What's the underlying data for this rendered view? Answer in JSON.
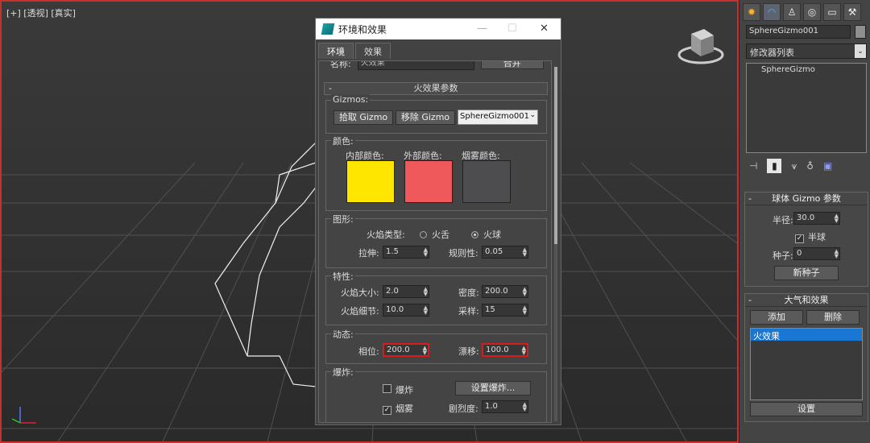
{
  "viewport": {
    "label": "[+] [透视] [真实]"
  },
  "dialog": {
    "title": "环境和效果",
    "tabs": [
      "环境",
      "效果"
    ],
    "top_row": {
      "name_label": "名称:",
      "name_value": "火效果",
      "merge_label": "合并"
    },
    "rollout_title": "火效果参数",
    "gizmos": {
      "label": "Gizmos:",
      "pick_button": "拾取 Gizmo",
      "remove_button": "移除 Gizmo",
      "selected": "SphereGizmo001"
    },
    "colors": {
      "label": "颜色:",
      "inner_label": "内部颜色:",
      "outer_label": "外部颜色:",
      "smoke_label": "烟雾颜色:",
      "inner_color": "#ffe600",
      "outer_color": "#f0595c",
      "smoke_color": "#4d4d4f"
    },
    "shape": {
      "label": "图形:",
      "flame_type_label": "火焰类型:",
      "opt_tendril": "火舌",
      "opt_fireball": "火球",
      "selected": "火球",
      "stretch_label": "拉伸:",
      "stretch_value": "1.5",
      "regularity_label": "规则性:",
      "regularity_value": "0.05"
    },
    "characteristics": {
      "label": "特性:",
      "size_label": "火焰大小:",
      "size_value": "2.0",
      "density_label": "密度:",
      "density_value": "200.0",
      "detail_label": "火焰细节:",
      "detail_value": "10.0",
      "samples_label": "采样:",
      "samples_value": "15"
    },
    "motion": {
      "label": "动态:",
      "phase_label": "相位:",
      "phase_value": "200.0",
      "drift_label": "漂移:",
      "drift_value": "100.0"
    },
    "explosion": {
      "label": "爆炸:",
      "explode_label": "爆炸",
      "explode_checked": false,
      "setup_button": "设置爆炸...",
      "smoke_label": "烟雾",
      "smoke_checked": true,
      "fury_label": "剧烈度:",
      "fury_value": "1.0"
    }
  },
  "cmd_panel": {
    "tabs": [
      "create-icon",
      "modify-icon",
      "hierarchy-icon",
      "motion-icon",
      "display-icon",
      "utilities-icon"
    ],
    "object_name": "SphereGizmo001",
    "object_color": "#8f8f8f",
    "modifier_list": "修改器列表",
    "stack_item": "SphereGizmo",
    "gizmo_rollout": {
      "title": "球体 Gizmo 参数",
      "radius_label": "半径:",
      "radius_value": "30.0",
      "hemisphere_label": "半球",
      "hemisphere_checked": true,
      "seed_label": "种子:",
      "seed_value": "0",
      "new_seed_button": "新种子"
    },
    "atmos_rollout": {
      "title": "大气和效果",
      "add_button": "添加",
      "delete_button": "删除",
      "list_item": "火效果",
      "setup_button": "设置"
    }
  }
}
